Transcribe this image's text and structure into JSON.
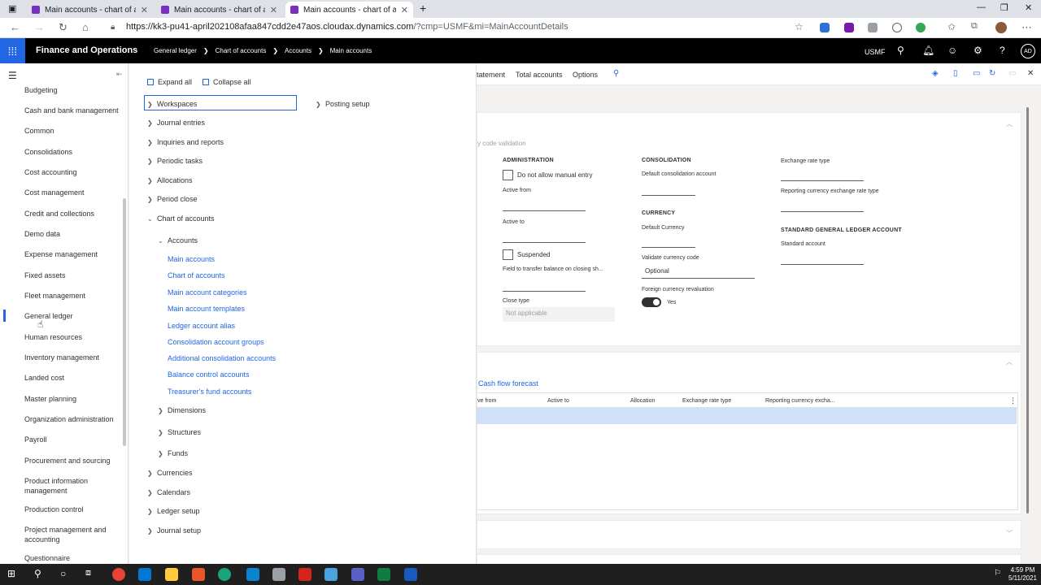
{
  "browser": {
    "tabs": [
      {
        "title": "Main accounts - chart of accounts"
      },
      {
        "title": "Main accounts - chart of accounts"
      },
      {
        "title": "Main accounts - chart of accounts"
      }
    ],
    "new_tab": "+",
    "url_host": "https://kk3-pu41-april202108afaa847cdd2e47aos.cloudax.dynamics.com",
    "url_rest": "/?cmp=USMF&mi=MainAccountDetails"
  },
  "header": {
    "app_name": "Finance and Operations",
    "breadcrumbs": [
      "General ledger",
      "Chart of accounts",
      "Accounts",
      "Main accounts"
    ],
    "company": "USMF",
    "avatar": "AD"
  },
  "leftnav": {
    "items": [
      "Budgeting",
      "Cash and bank management",
      "Common",
      "Consolidations",
      "Cost accounting",
      "Cost management",
      "Credit and collections",
      "Demo data",
      "Expense management",
      "Fixed assets",
      "Fleet management",
      "General ledger",
      "Human resources",
      "Inventory management",
      "Landed cost",
      "Master planning",
      "Organization administration",
      "Payroll",
      "Procurement and sourcing",
      "Product information management",
      "Production control",
      "Project management and accounting",
      "Questionnaire"
    ]
  },
  "flyout": {
    "expand_all": "Expand all",
    "collapse_all": "Collapse all",
    "workspaces": "Workspaces",
    "posting_setup": "Posting setup",
    "sections": [
      "Journal entries",
      "Inquiries and reports",
      "Periodic tasks",
      "Allocations",
      "Period close"
    ],
    "chart_of_accounts": "Chart of accounts",
    "accounts": "Accounts",
    "account_links": [
      "Main accounts",
      "Chart of accounts",
      "Main account categories",
      "Main account templates",
      "Ledger account alias",
      "Consolidation account groups",
      "Additional consolidation accounts",
      "Balance control accounts",
      "Treasurer's fund accounts"
    ],
    "sub_sections": [
      "Dimensions",
      "Structures",
      "Funds"
    ],
    "bottom_sections": [
      "Currencies",
      "Calendars",
      "Ledger setup",
      "Journal setup"
    ]
  },
  "actionpane": {
    "items": [
      "tatement",
      "Total accounts",
      "Options"
    ]
  },
  "form": {
    "faded_text": "y code validation",
    "administration": {
      "heading": "ADMINISTRATION",
      "do_not_allow": "Do not allow manual entry",
      "active_from": "Active from",
      "active_to": "Active to",
      "suspended": "Suspended",
      "transfer_balance": "Field to transfer balance on closing sh...",
      "close_type": "Close type",
      "close_type_value": "Not applicable"
    },
    "consolidation": {
      "heading": "CONSOLIDATION",
      "default_account": "Default consolidation account"
    },
    "currency": {
      "heading": "CURRENCY",
      "default_currency": "Default Currency",
      "validate_code": "Validate currency code",
      "validate_value": "Optional",
      "foreign_reval": "Foreign currency revaluation",
      "foreign_reval_value": "Yes"
    },
    "exchange": {
      "rate_type": "Exchange rate type",
      "reporting_rate_type": "Reporting currency exchange rate type"
    },
    "sgl": {
      "heading": "STANDARD GENERAL LEDGER ACCOUNT",
      "standard_account": "Standard account"
    }
  },
  "grid": {
    "link": "Cash flow forecast",
    "columns": [
      "ve from",
      "Active to",
      "Allocation",
      "Exchange rate type",
      "Reporting currency excha..."
    ]
  },
  "taskbar": {
    "time": "4:59 PM",
    "date": "5/11/2021"
  }
}
